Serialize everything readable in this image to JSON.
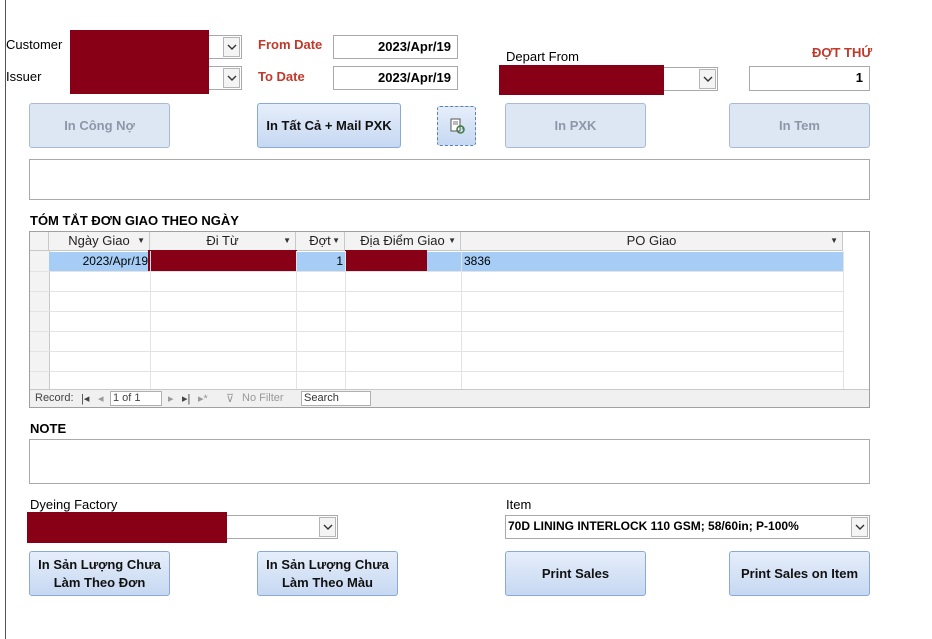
{
  "filters": {
    "customer_label": "Customer",
    "issuer_label": "Issuer",
    "from_date_label": "From Date",
    "to_date_label": "To Date",
    "from_date_value": "2023/Apr/19",
    "to_date_value": "2023/Apr/19",
    "depart_from_label": "Depart From",
    "dot_thu_label": "ĐỢT THỨ",
    "dot_thu_value": "1"
  },
  "buttons": {
    "in_cong_no": "In Công Nợ",
    "in_tat_ca_mail": "In Tất Cả + Mail PXK",
    "in_pxk": "In PXK",
    "in_tem": "In Tem",
    "in_san_luong_don_line1": "In Sản Lượng Chưa",
    "in_san_luong_don_line2": "Làm Theo Đơn",
    "in_san_luong_mau_line1": "In Sản Lượng Chưa",
    "in_san_luong_mau_line2": "Làm Theo Màu",
    "print_sales": "Print Sales",
    "print_sales_item": "Print Sales on Item"
  },
  "summary": {
    "title": "TÓM TẮT ĐƠN GIAO THEO NGÀY",
    "columns": [
      "Ngày Giao",
      "Đi Từ",
      "Đợt",
      "Địa Điểm Giao",
      "PO Giao"
    ],
    "rows": [
      {
        "ngay_giao": "2023/Apr/19",
        "dot": "1",
        "po_giao": "3836"
      }
    ],
    "nav": {
      "record_label": "Record:",
      "position": "1 of 1",
      "no_filter": "No Filter",
      "search": "Search"
    }
  },
  "note": {
    "label": "NOTE"
  },
  "dyeing": {
    "label": "Dyeing Factory"
  },
  "item": {
    "label": "Item",
    "value": "70D LINING INTERLOCK 110 GSM; 58/60in; P-100%"
  },
  "colors": {
    "redaction": "#880015",
    "accent_red": "#c0392b",
    "selected_row": "#a6cdf5",
    "button_blue": "#c6d8f2"
  }
}
